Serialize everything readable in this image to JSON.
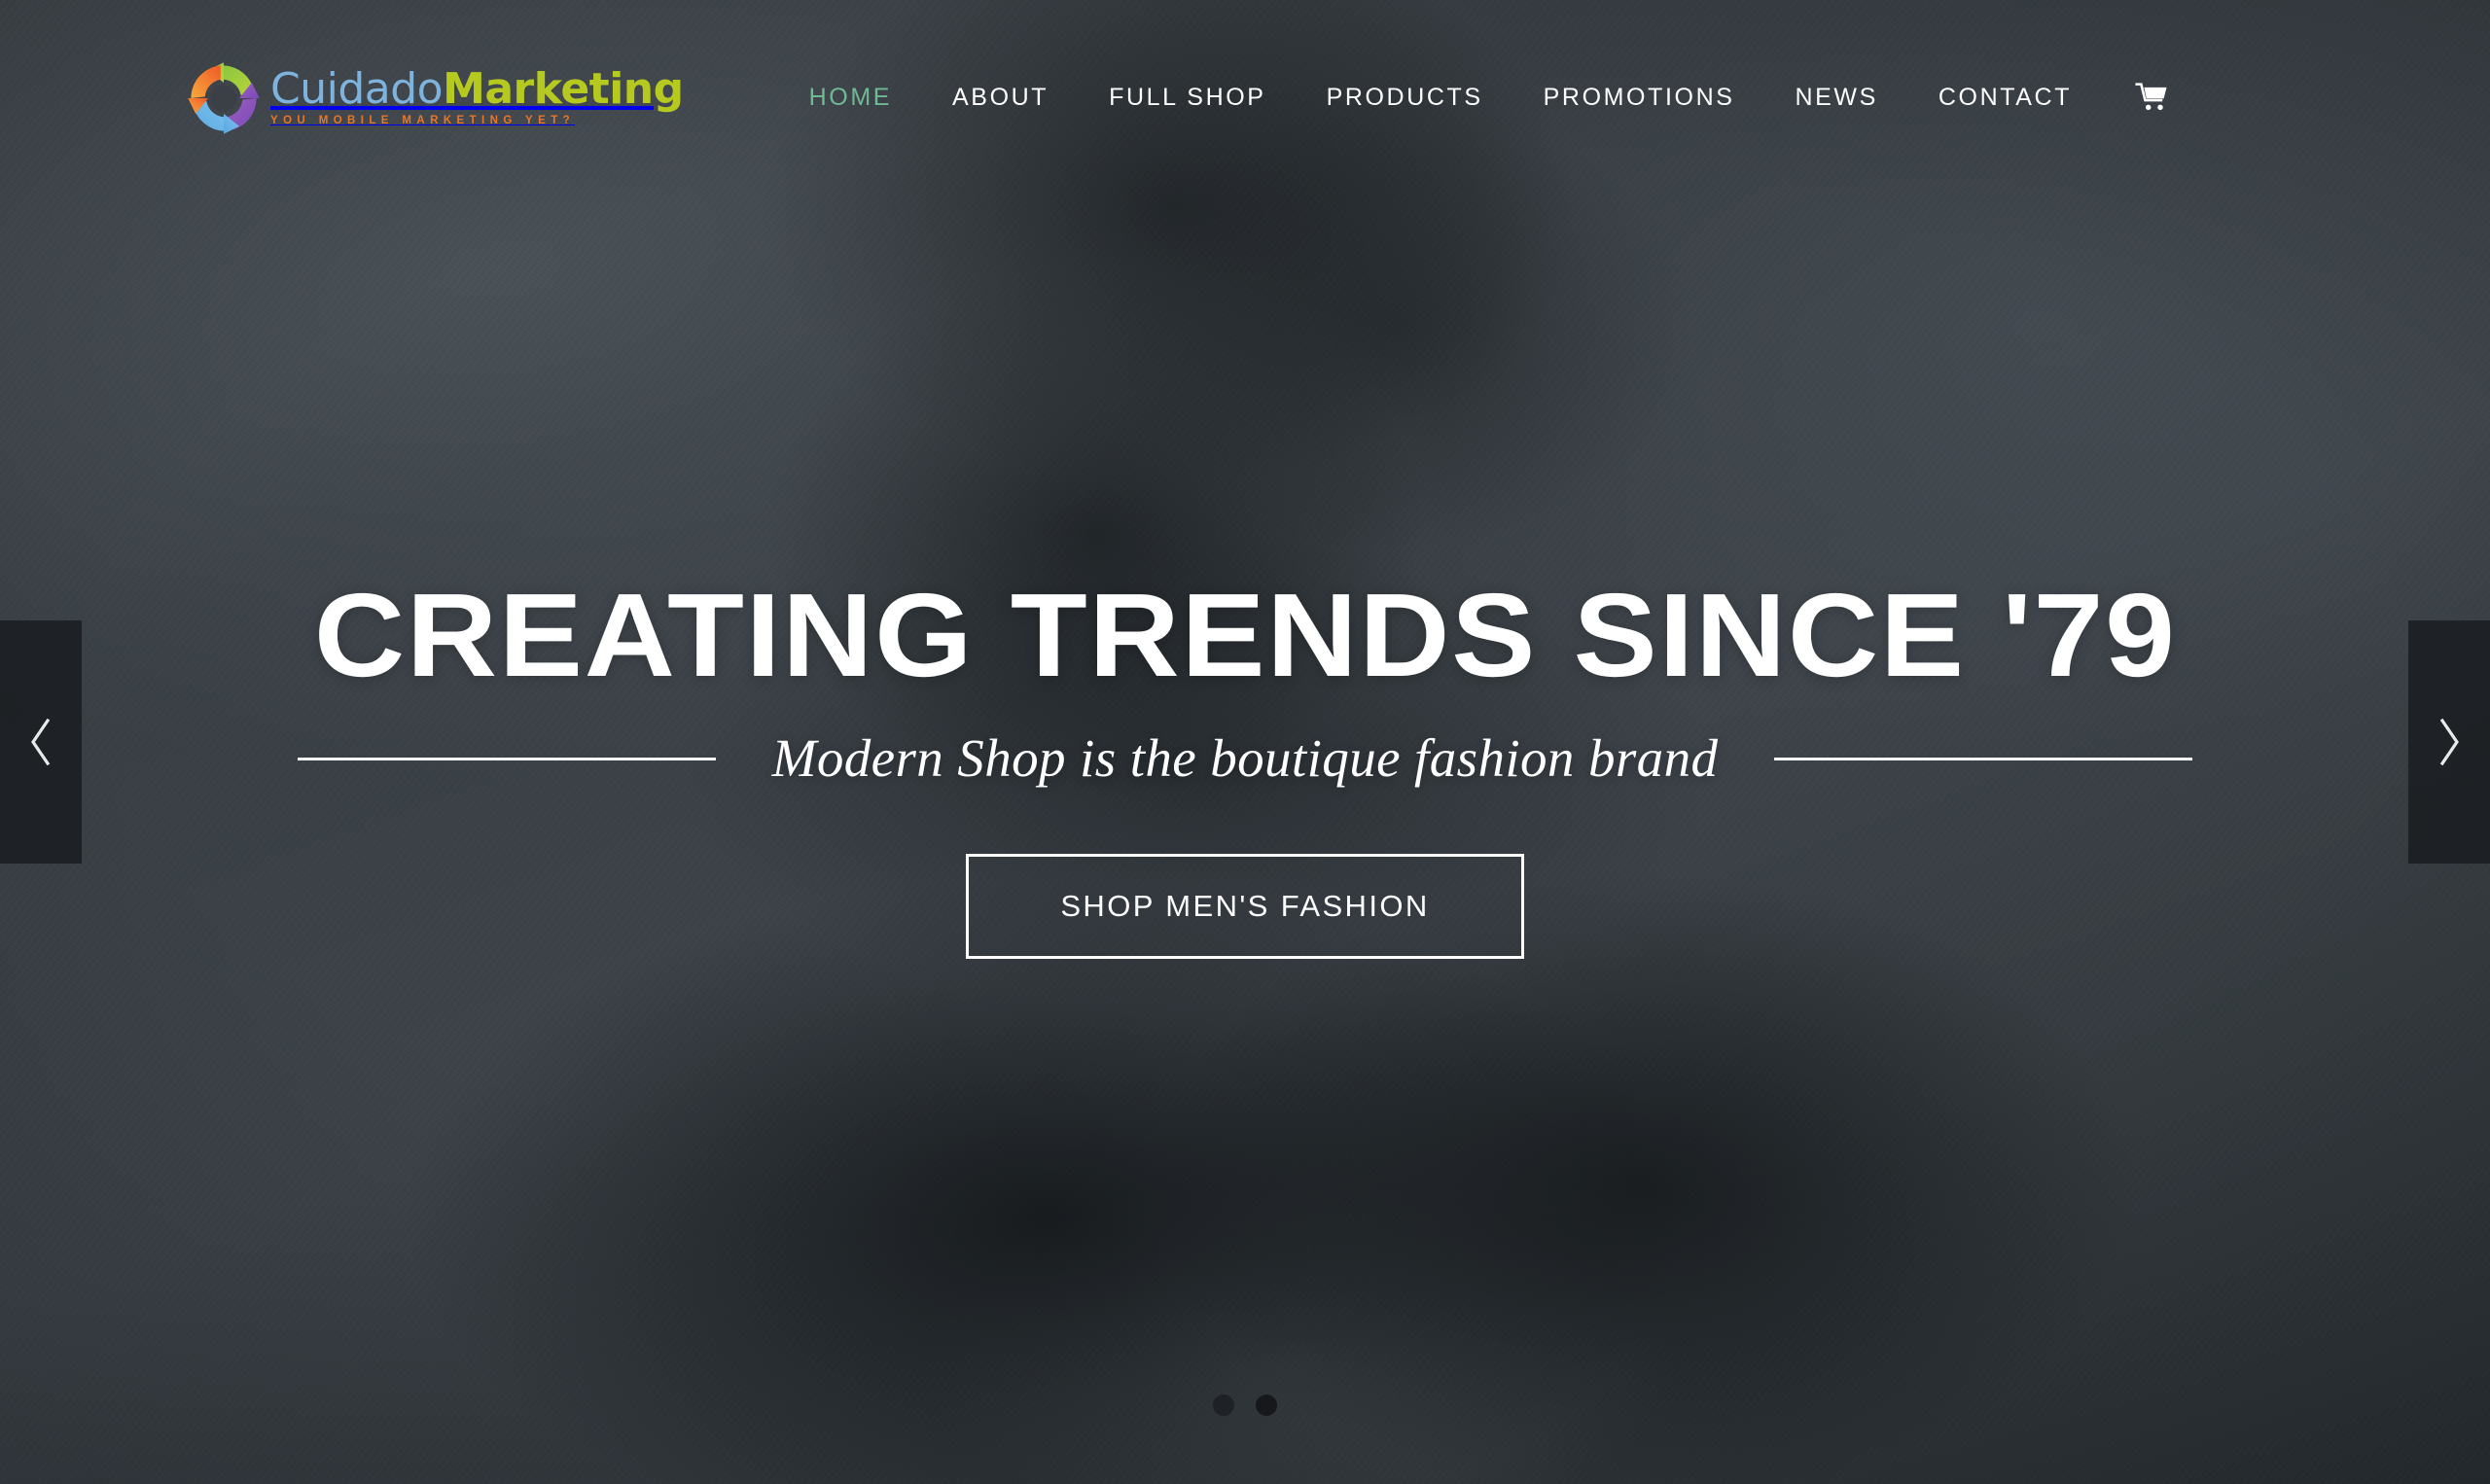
{
  "brand": {
    "icon": "circular-arrows-logo-icon",
    "name_part1": "Cuidado",
    "name_part2": "Marketing",
    "tagline": "You Mobile Marketing Yet?",
    "colors": {
      "part1": "#7db3dd",
      "part2": "#b5c91f",
      "tagline": "#e8762a"
    }
  },
  "nav": {
    "items": [
      {
        "label": "HOME",
        "active": true
      },
      {
        "label": "ABOUT",
        "active": false
      },
      {
        "label": "FULL SHOP",
        "active": false
      },
      {
        "label": "PRODUCTS",
        "active": false
      },
      {
        "label": "PROMOTIONS",
        "active": false
      },
      {
        "label": "NEWS",
        "active": false
      },
      {
        "label": "CONTACT",
        "active": false
      }
    ],
    "cart_icon": "shopping-cart-icon",
    "active_color": "#6fba93",
    "text_color": "#ffffff"
  },
  "slide": {
    "title": "CREATING TRENDS SINCE '79",
    "subtitle": "Modern Shop is the boutique fashion brand",
    "cta_label": "SHOP MEN'S FASHION"
  },
  "slider": {
    "prev_icon": "chevron-left-icon",
    "next_icon": "chevron-right-icon",
    "dots": [
      {
        "label": "1",
        "active": false
      },
      {
        "label": "2",
        "active": true
      }
    ]
  },
  "theme": {
    "background": "#3a4046",
    "overlay_dark": "#181b1f"
  }
}
